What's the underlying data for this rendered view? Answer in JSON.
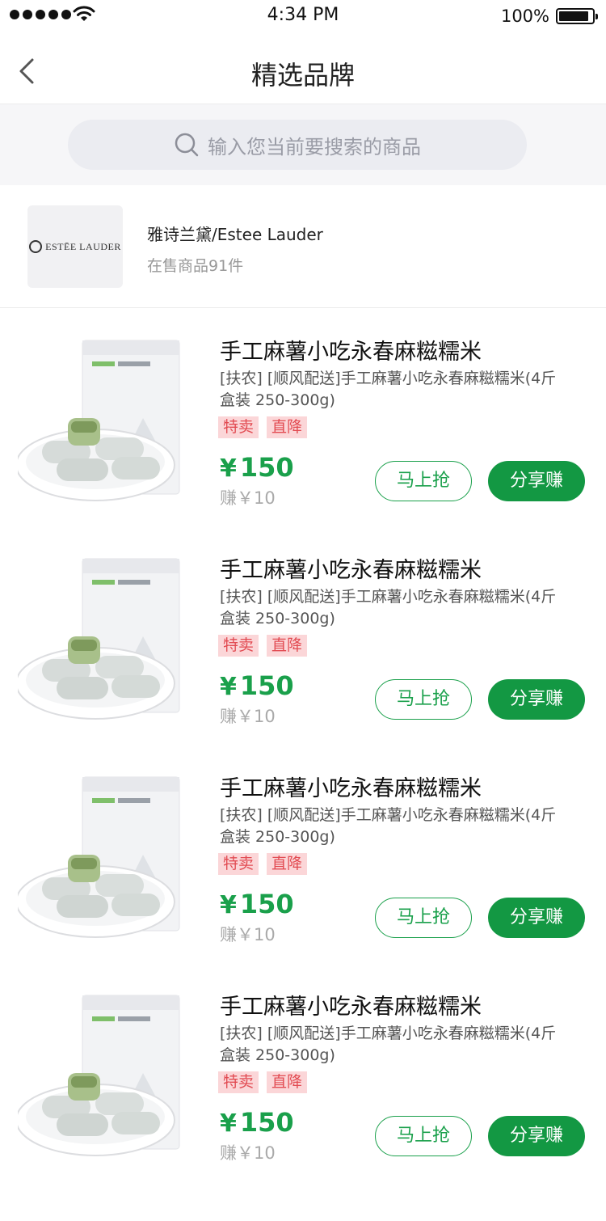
{
  "status_bar": {
    "time": "4:34 PM",
    "battery_percent": "100%"
  },
  "nav": {
    "title": "精选品牌",
    "back_icon": "chevron-left-icon"
  },
  "search": {
    "placeholder": "输入您当前要搜索的商品",
    "icon": "search-icon"
  },
  "brand": {
    "logo_text": "ESTĒE LAUDER",
    "name": "雅诗兰黛/Estee Lauder",
    "product_count": "在售商品91件"
  },
  "products": [
    {
      "title": "手工麻薯小吃永春麻糍糯米",
      "description": "[扶农] [顺风配送]手工麻薯小吃永春麻糍糯米(4斤盒装 250-300g)",
      "tags": [
        "特卖",
        "直降"
      ],
      "currency": "¥",
      "price": "150",
      "earn": "赚￥10",
      "buy_label": "马上抢",
      "share_label": "分享赚"
    },
    {
      "title": "手工麻薯小吃永春麻糍糯米",
      "description": "[扶农] [顺风配送]手工麻薯小吃永春麻糍糯米(4斤盒装 250-300g)",
      "tags": [
        "特卖",
        "直降"
      ],
      "currency": "¥",
      "price": "150",
      "earn": "赚￥10",
      "buy_label": "马上抢",
      "share_label": "分享赚"
    },
    {
      "title": "手工麻薯小吃永春麻糍糯米",
      "description": "[扶农] [顺风配送]手工麻薯小吃永春麻糍糯米(4斤盒装 250-300g)",
      "tags": [
        "特卖",
        "直降"
      ],
      "currency": "¥",
      "price": "150",
      "earn": "赚￥10",
      "buy_label": "马上抢",
      "share_label": "分享赚"
    },
    {
      "title": "手工麻薯小吃永春麻糍糯米",
      "description": "[扶农] [顺风配送]手工麻薯小吃永春麻糍糯米(4斤盒装 250-300g)",
      "tags": [
        "特卖",
        "直降"
      ],
      "currency": "¥",
      "price": "150",
      "earn": "赚￥10",
      "buy_label": "马上抢",
      "share_label": "分享赚"
    }
  ],
  "colors": {
    "accent_green": "#1aa04b",
    "share_button_green": "#139843",
    "tag_background": "#fbd6d8",
    "tag_text": "#e24b52"
  }
}
